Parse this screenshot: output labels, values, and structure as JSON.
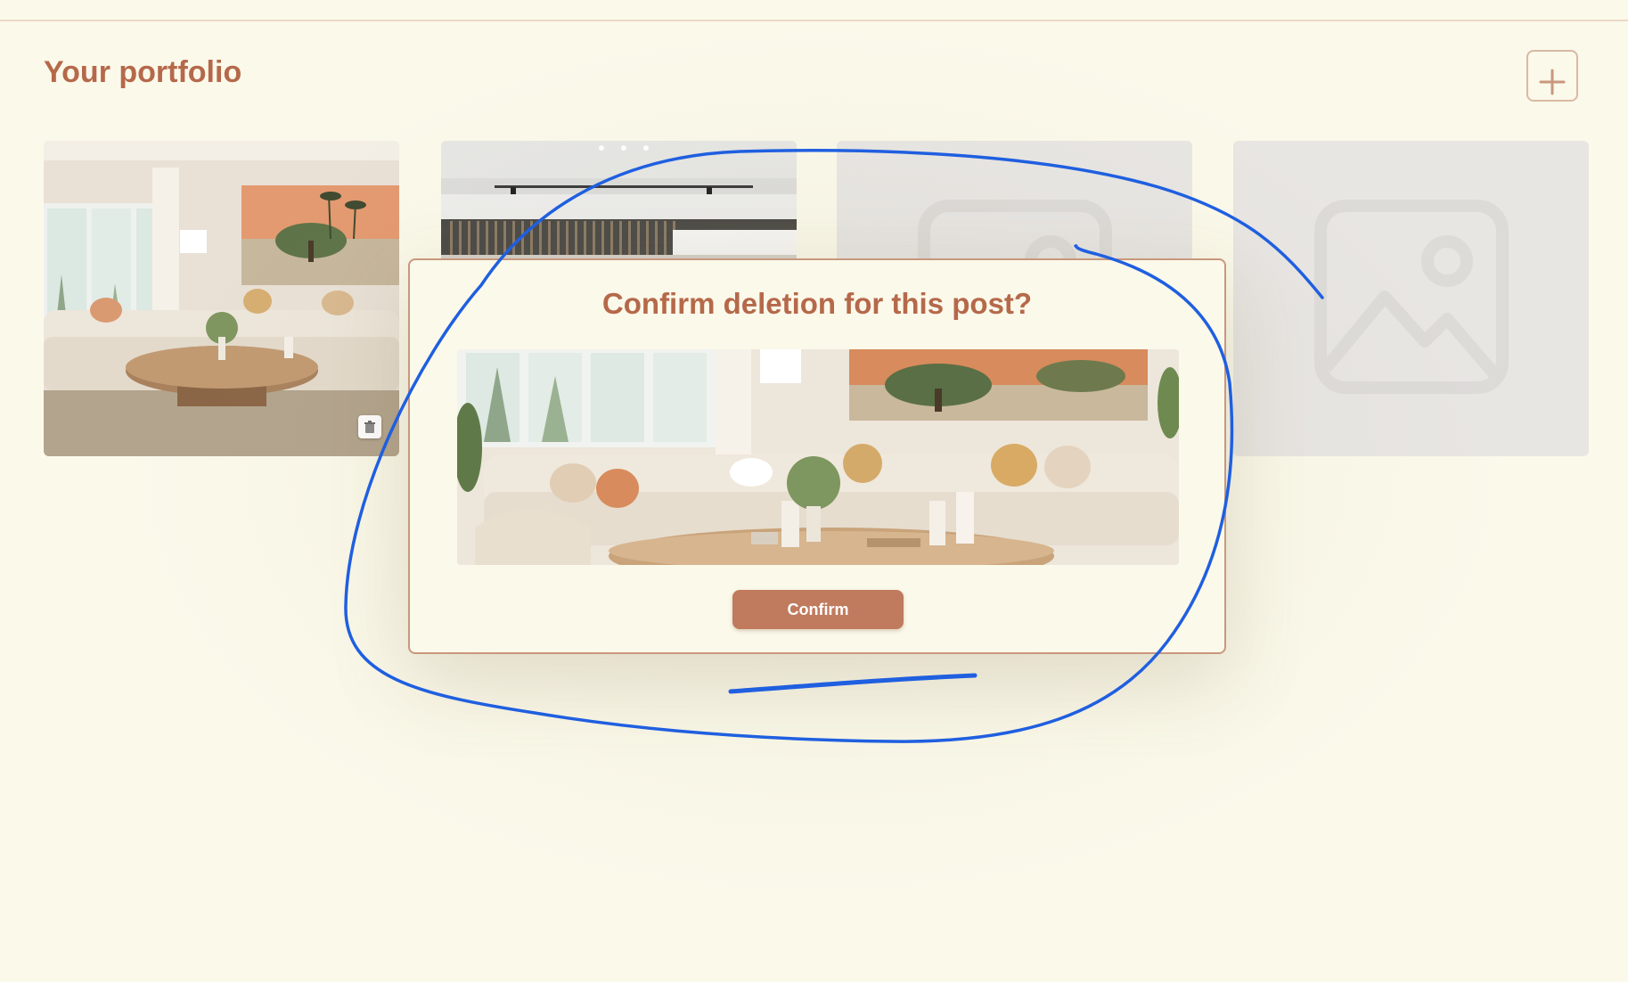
{
  "header": {
    "title": "Your portfolio"
  },
  "grid": {
    "items": [
      {
        "kind": "photo",
        "subject": "living-room"
      },
      {
        "kind": "photo",
        "subject": "modern-interior"
      },
      {
        "kind": "placeholder",
        "icon": "image-placeholder-icon"
      },
      {
        "kind": "placeholder",
        "icon": "image-placeholder-icon"
      }
    ]
  },
  "modal": {
    "title": "Confirm deletion for this post?",
    "confirm_label": "Confirm"
  },
  "colors": {
    "background": "#FBF9EA",
    "accent": "#B5694A",
    "button": "#C07A5D",
    "annotation": "#1F5FE0"
  }
}
